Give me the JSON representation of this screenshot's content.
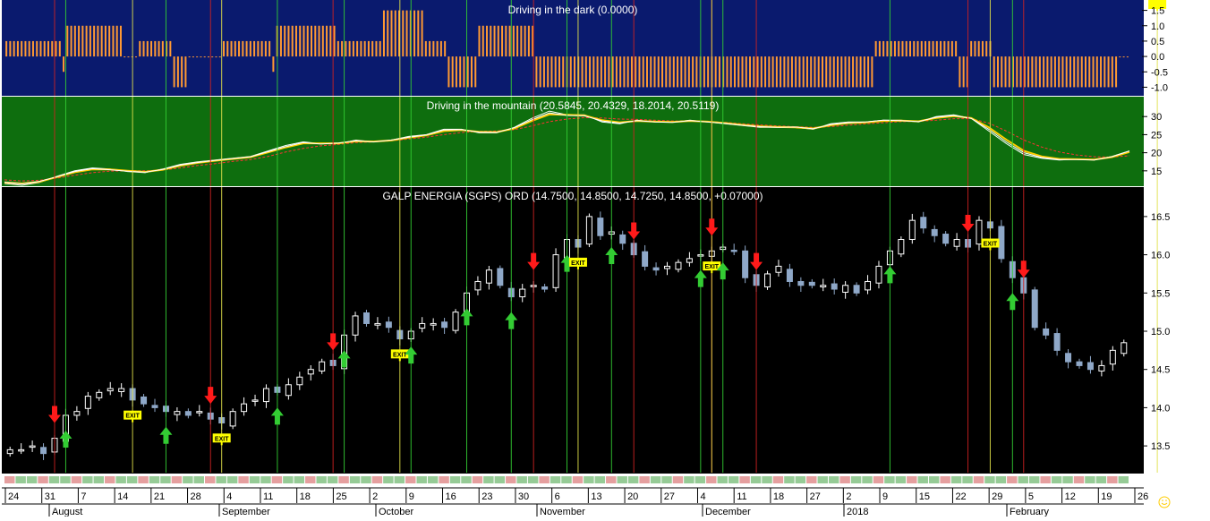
{
  "chart_data": [
    {
      "type": "bar",
      "title": "Driving in the dark (0.0000)",
      "y_ticks": [
        "1.5",
        "1.0",
        "0.5",
        "0.0",
        "-0.5",
        "-1.0"
      ],
      "ylim": [
        -1.25,
        1.75
      ],
      "colors": {
        "background": "#0a1a6e",
        "bar": "#ff9933"
      },
      "series": [
        {
          "values": [
            0.5,
            0.5,
            0.5,
            0.5,
            0.5,
            0.5,
            0.5,
            0.5,
            0.5,
            0.5,
            0.5,
            0.5,
            0.5,
            0.5,
            0.5,
            -0.5,
            1.0,
            1.0,
            1.0,
            1.0,
            1.0,
            1.0,
            1.0,
            1.0,
            1.0,
            1.0,
            1.0,
            1.0,
            1.0,
            1.0,
            1.0,
            0.0,
            0.0,
            0.0,
            0.0,
            0.5,
            0.5,
            0.5,
            0.5,
            0.5,
            0.5,
            0.5,
            0.5,
            0.5,
            -1.0,
            -1.0,
            -1.0,
            -1.0,
            0.0,
            0.0,
            0.0,
            0.0,
            0.0,
            0.0,
            0.0,
            0.0,
            0.0,
            0.5,
            0.5,
            0.5,
            0.5,
            0.5,
            0.5,
            0.5,
            0.5,
            0.5,
            0.5,
            0.5,
            0.5,
            0.5,
            -0.5,
            1.0,
            1.0,
            1.0,
            1.0,
            1.0,
            1.0,
            1.0,
            1.0,
            1.0,
            1.0,
            1.0,
            1.0,
            1.0,
            1.0,
            1.0,
            1.0,
            0.5,
            0.5,
            0.5,
            0.5,
            0.5,
            0.5,
            0.5,
            0.5,
            0.5,
            0.5,
            0.5,
            0.5,
            1.5,
            1.5,
            1.5,
            1.5,
            1.5,
            1.5,
            1.5,
            1.5,
            1.5,
            1.5,
            1.5,
            0.5,
            0.5,
            0.5,
            0.5,
            0.5,
            0.5,
            -1.0,
            -1.0,
            -1.0,
            -1.0,
            -1.0,
            -1.0,
            -1.0,
            -1.0,
            1.0,
            1.0,
            1.0,
            1.0,
            1.0,
            1.0,
            1.0,
            1.0,
            1.0,
            1.0,
            1.0,
            1.0,
            1.0,
            1.0,
            1.0,
            -1.0,
            -1.0,
            -1.0,
            -1.0,
            -1.0,
            -1.0,
            -1.0,
            -1.0,
            -1.0,
            -1.0,
            -1.0,
            -1.0,
            -1.0,
            -1.0,
            -1.0,
            -1.0,
            -1.0,
            -1.0,
            -1.0,
            -1.0,
            -1.0,
            -1.0,
            -1.0,
            -1.0,
            -1.0,
            -1.0,
            -1.0,
            -1.0,
            -1.0,
            -1.0,
            -1.0,
            -1.0,
            -1.0,
            -1.0,
            -1.0,
            -1.0,
            -1.0,
            -1.0,
            -1.0,
            -1.0,
            -1.0,
            -1.0,
            -1.0,
            -1.0,
            -1.0,
            -1.0,
            -1.0,
            -1.0,
            -1.0,
            -1.0,
            -1.0,
            -1.0,
            -1.0,
            -1.0,
            -1.0,
            -1.0,
            -1.0,
            -1.0,
            -1.0,
            -1.0,
            -1.0,
            -1.0,
            -1.0,
            -1.0,
            -1.0,
            -1.0,
            -1.0,
            -1.0,
            -1.0,
            -1.0,
            -1.0,
            -1.0,
            -1.0,
            -1.0,
            -1.0,
            -1.0,
            -1.0,
            -1.0,
            -1.0,
            -1.0,
            -1.0,
            -1.0,
            -1.0,
            -1.0,
            -1.0,
            -1.0,
            -1.0,
            -1.0,
            -1.0,
            0.5,
            0.5,
            0.5,
            0.5,
            0.5,
            0.5,
            0.5,
            0.5,
            0.5,
            0.5,
            0.5,
            0.5,
            0.5,
            0.5,
            0.5,
            0.5,
            0.5,
            0.5,
            0.5,
            0.5,
            0.5,
            0.5,
            -1.0,
            -1.0,
            -1.0,
            0.5,
            0.5,
            0.5,
            0.5,
            0.5,
            0.5,
            -1.0,
            -1.0,
            -1.0,
            -1.0,
            -1.0,
            -1.0,
            -1.0,
            -1.0,
            -1.0,
            -1.0,
            -1.0,
            -1.0,
            -1.0,
            -1.0,
            -1.0,
            -1.0,
            -1.0,
            -1.0,
            -1.0,
            -1.0,
            -1.0,
            -1.0,
            -1.0,
            -1.0,
            -1.0,
            -1.0,
            -1.0,
            -1.0,
            -1.0,
            -1.0,
            -1.0,
            -1.0,
            -1.0,
            0.0,
            0.0,
            0.0
          ]
        }
      ]
    },
    {
      "type": "line",
      "title": "Driving in the mountain (20.5845, 20.4329, 18.2014, 20.5119)",
      "y_ticks": [
        "30",
        "25",
        "20",
        "15"
      ],
      "ylim": [
        11,
        35
      ],
      "colors": {
        "background": "#0e6e0e",
        "line1": "#ffffff",
        "line2": "#ffcc00",
        "line3": "#ff3333"
      },
      "series": [
        {
          "values": [
            11.5,
            11.0,
            11.8,
            13.5,
            15.0,
            15.8,
            15.5,
            14.8,
            14.5,
            15.5,
            16.8,
            17.5,
            18.0,
            18.5,
            19.0,
            20.5,
            22.0,
            23.0,
            22.5,
            22.5,
            23.5,
            23.0,
            23.5,
            24.5,
            25.0,
            26.5,
            26.5,
            25.5,
            25.5,
            27.0,
            29.5,
            31.5,
            30.5,
            30.5,
            28.5,
            28.0,
            29.0,
            28.5,
            28.5,
            29.0,
            28.5,
            28.0,
            27.5,
            27.0,
            27.0,
            27.0,
            26.5,
            28.0,
            28.5,
            28.5,
            29.0,
            29.0,
            28.5,
            30.0,
            30.5,
            29.5,
            26.0,
            22.5,
            19.5,
            18.5,
            18.0,
            18.2,
            18.0,
            19.0,
            20.5
          ]
        },
        {
          "values": [
            11.8,
            11.5,
            12.0,
            13.3,
            14.6,
            15.4,
            15.4,
            15.0,
            14.7,
            15.3,
            16.4,
            17.2,
            17.8,
            18.3,
            18.8,
            20.1,
            21.5,
            22.6,
            22.6,
            22.6,
            23.2,
            23.1,
            23.4,
            24.2,
            24.8,
            26.0,
            26.3,
            25.8,
            25.7,
            26.7,
            28.8,
            30.6,
            30.5,
            30.3,
            29.0,
            28.4,
            28.8,
            28.6,
            28.5,
            28.8,
            28.6,
            28.2,
            27.7,
            27.3,
            27.1,
            27.0,
            26.7,
            27.6,
            28.2,
            28.4,
            28.8,
            28.9,
            28.7,
            29.6,
            30.1,
            29.6,
            27.0,
            23.6,
            20.5,
            19.0,
            18.3,
            18.2,
            18.1,
            18.8,
            20.2
          ]
        },
        {
          "values": [
            12.5,
            12.2,
            12.4,
            13.0,
            13.8,
            14.5,
            14.9,
            15.0,
            15.0,
            15.2,
            15.8,
            16.5,
            17.0,
            17.6,
            18.1,
            19.0,
            20.2,
            21.2,
            21.9,
            22.3,
            22.8,
            23.0,
            23.3,
            23.8,
            24.3,
            25.0,
            25.6,
            25.9,
            26.0,
            26.4,
            27.4,
            28.6,
            29.3,
            29.7,
            29.6,
            29.3,
            29.2,
            29.0,
            28.8,
            28.7,
            28.6,
            28.4,
            28.0,
            27.7,
            27.4,
            27.2,
            27.0,
            27.2,
            27.6,
            28.0,
            28.3,
            28.6,
            28.7,
            29.0,
            29.4,
            29.4,
            28.2,
            26.0,
            23.5,
            21.6,
            20.2,
            19.4,
            18.9,
            18.8,
            19.2
          ]
        },
        {
          "values": [
            11.9,
            11.4,
            12.1,
            13.4,
            14.8,
            15.6,
            15.3,
            14.9,
            14.6,
            15.4,
            16.6,
            17.3,
            17.9,
            18.4,
            18.9,
            20.3,
            21.7,
            22.8,
            22.4,
            22.7,
            23.3,
            23.0,
            23.5,
            24.3,
            24.9,
            26.3,
            26.4,
            25.7,
            25.6,
            26.9,
            29.1,
            31.0,
            30.3,
            30.2,
            28.8,
            28.2,
            28.9,
            28.5,
            28.4,
            28.9,
            28.5,
            28.1,
            27.6,
            27.2,
            27.0,
            27.1,
            26.6,
            27.8,
            28.3,
            28.5,
            29.0,
            28.9,
            28.6,
            29.8,
            30.3,
            29.5,
            26.5,
            23.0,
            20.0,
            18.7,
            18.1,
            18.1,
            18.0,
            18.9,
            20.5
          ]
        }
      ]
    },
    {
      "type": "candlestick",
      "title": "GALP ENERGIA (SGPS) ORD (14.7500, 14.8500, 14.7250, 14.8500, +0.07000)",
      "y_ticks": [
        "16.5",
        "16.0",
        "15.5",
        "15.0",
        "14.5",
        "14.0",
        "13.5"
      ],
      "ylim": [
        13.15,
        16.85
      ],
      "colors": {
        "background": "#000000",
        "up": "#ffffff",
        "down": "#8fa8c8",
        "buy": "#33cc33",
        "sell": "#ff1a1a",
        "exit": "#ffff00"
      },
      "closes": [
        13.45,
        13.45,
        13.5,
        13.4,
        13.6,
        13.9,
        13.95,
        14.15,
        14.2,
        14.25,
        14.25,
        14.1,
        14.05,
        14.0,
        13.95,
        13.95,
        13.9,
        13.95,
        13.85,
        13.8,
        13.95,
        14.05,
        14.1,
        14.25,
        14.2,
        14.3,
        14.4,
        14.5,
        14.6,
        14.55,
        14.95,
        15.2,
        15.1,
        15.1,
        15.05,
        14.9,
        15.0,
        15.1,
        15.1,
        15.05,
        15.25,
        15.5,
        15.65,
        15.8,
        15.6,
        15.45,
        15.55,
        15.6,
        15.55,
        16.0,
        16.2,
        16.1,
        16.5,
        16.25,
        16.3,
        16.15,
        16.0,
        15.85,
        15.8,
        15.85,
        15.9,
        15.95,
        16.0,
        16.05,
        16.1,
        16.05,
        15.7,
        15.6,
        15.75,
        15.85,
        15.65,
        15.6,
        15.6,
        15.6,
        15.55,
        15.6,
        15.5,
        15.65,
        15.85,
        16.05,
        16.2,
        16.45,
        16.35,
        16.25,
        16.15,
        16.2,
        16.1,
        16.45,
        16.35,
        15.95,
        15.7,
        15.5,
        15.05,
        14.95,
        14.75,
        14.6,
        14.55,
        14.5,
        14.55,
        14.75,
        14.85
      ],
      "signals": [
        {
          "type": "sell",
          "label": "↓",
          "x_index": 4
        },
        {
          "type": "buy",
          "label": "↑",
          "x_index": 5
        },
        {
          "type": "exit",
          "label": "EXIT",
          "x_index": 11
        },
        {
          "type": "buy",
          "label": "↑",
          "x_index": 14
        },
        {
          "type": "sell",
          "label": "↓",
          "x_index": 18
        },
        {
          "type": "exit",
          "label": "EXIT",
          "x_index": 19
        },
        {
          "type": "buy",
          "label": "↑",
          "x_index": 24
        },
        {
          "type": "sell",
          "label": "↓",
          "x_index": 29
        },
        {
          "type": "buy",
          "label": "↑",
          "x_index": 30
        },
        {
          "type": "exit",
          "label": "EXIT",
          "x_index": 35
        },
        {
          "type": "buy",
          "label": "↑",
          "x_index": 36
        },
        {
          "type": "buy",
          "label": "↑",
          "x_index": 41
        },
        {
          "type": "buy",
          "label": "↑",
          "x_index": 45
        },
        {
          "type": "sell",
          "label": "↓",
          "x_index": 47
        },
        {
          "type": "buy",
          "label": "↑",
          "x_index": 50
        },
        {
          "type": "exit",
          "label": "EXIT",
          "x_index": 51
        },
        {
          "type": "buy",
          "label": "↑",
          "x_index": 54
        },
        {
          "type": "sell",
          "label": "↓",
          "x_index": 56
        },
        {
          "type": "buy",
          "label": "↑",
          "x_index": 62
        },
        {
          "type": "sell",
          "label": "↓",
          "x_index": 63
        },
        {
          "type": "exit",
          "label": "EXIT",
          "x_index": 63
        },
        {
          "type": "buy",
          "label": "↑",
          "x_index": 64
        },
        {
          "type": "sell",
          "label": "↓",
          "x_index": 67
        },
        {
          "type": "buy",
          "label": "↑",
          "x_index": 79
        },
        {
          "type": "sell",
          "label": "↓",
          "x_index": 86
        },
        {
          "type": "exit",
          "label": "EXIT",
          "x_index": 88
        },
        {
          "type": "buy",
          "label": "↑",
          "x_index": 90
        },
        {
          "type": "sell",
          "label": "↓",
          "x_index": 91
        },
        {
          "type": "exit",
          "label": "EXIT",
          "x_index": 103
        }
      ],
      "x_tick_labels": [
        "24",
        "31",
        "7",
        "14",
        "21",
        "28",
        "4",
        "11",
        "18",
        "25",
        "2",
        "9",
        "16",
        "23",
        "30",
        "6",
        "13",
        "20",
        "27",
        "4",
        "11",
        "18",
        "27",
        "2",
        "9",
        "15",
        "22",
        "29",
        "5",
        "12",
        "19",
        "26"
      ],
      "x_month_labels": [
        "August",
        "September",
        "October",
        "November",
        "December",
        "2018",
        "February"
      ]
    }
  ],
  "corner_icon": "smiley-icon"
}
